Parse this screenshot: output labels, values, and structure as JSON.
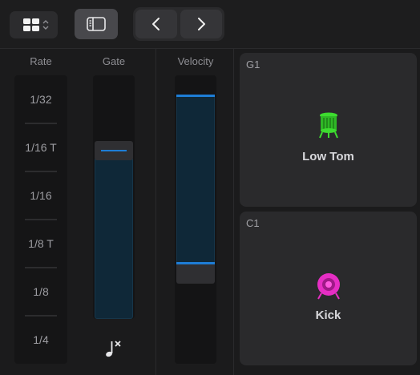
{
  "colors": {
    "accent": "#1e7dd6",
    "tom_green": "#3ddc2f",
    "kick_magenta": "#e62ec4"
  },
  "toolbar": {
    "view_icon": "grid-icon",
    "sidebar_icon": "sidebar-icon",
    "back_icon": "chevron-left-icon",
    "forward_icon": "chevron-right-icon"
  },
  "rate": {
    "label": "Rate",
    "options": [
      "1/32",
      "1/16 T",
      "1/16",
      "1/8 T",
      "1/8",
      "1/4"
    ]
  },
  "gate": {
    "label": "Gate",
    "level": 0.69,
    "footer_icon": "note-mute-icon"
  },
  "velocity": {
    "label": "Velocity",
    "range_high": 0.93,
    "range_low": 0.35
  },
  "pads": [
    {
      "note": "G1",
      "name": "Low Tom",
      "icon": "tom-drum-icon"
    },
    {
      "note": "C1",
      "name": "Kick",
      "icon": "kick-drum-icon"
    }
  ]
}
